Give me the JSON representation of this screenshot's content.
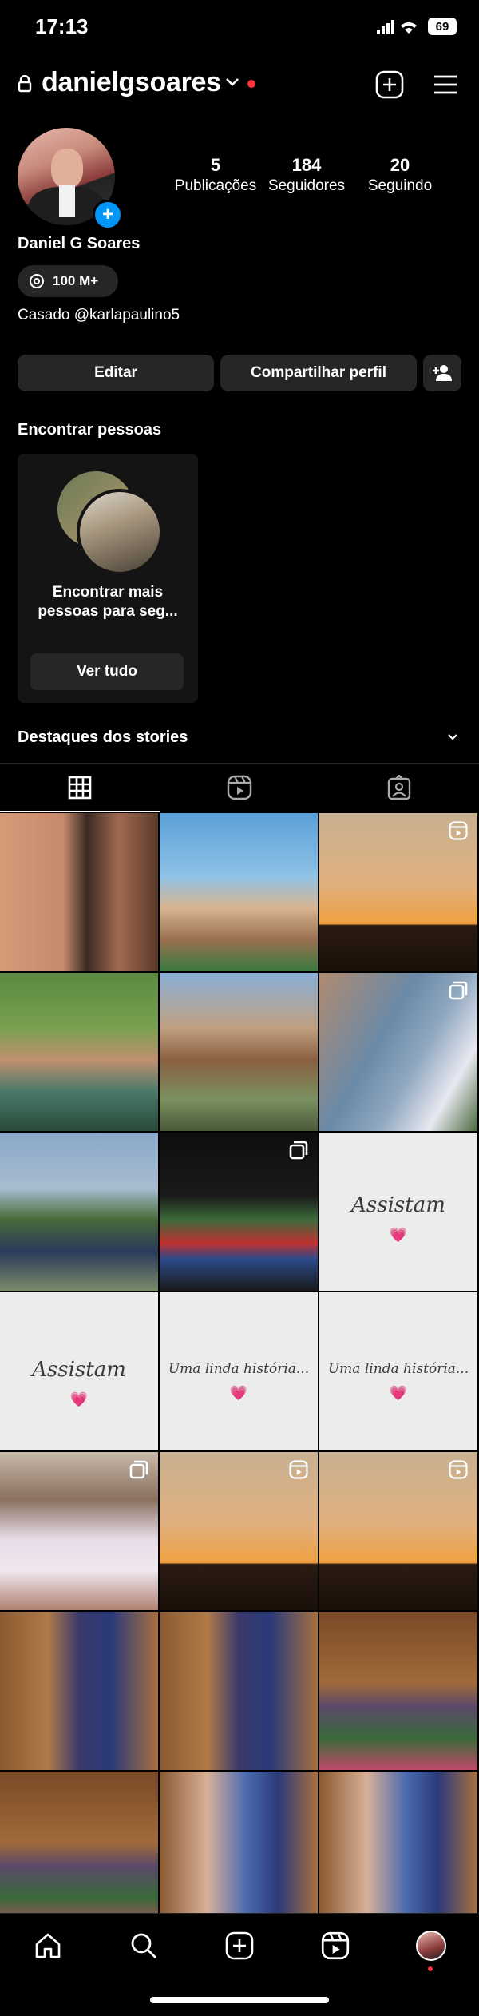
{
  "status_bar": {
    "time": "17:13",
    "battery": "69"
  },
  "profile": {
    "username": "danielgsoares",
    "name": "Daniel G Soares",
    "threads_label": "100 M+",
    "bio": "Casado @karlapaulino5",
    "stats": [
      {
        "value": "5",
        "label": "Publicações"
      },
      {
        "value": "184",
        "label": "Seguidores"
      },
      {
        "value": "20",
        "label": "Seguindo"
      }
    ]
  },
  "actions": {
    "edit": "Editar",
    "share": "Compartilhar perfil"
  },
  "find_people": {
    "title": "Encontrar pessoas",
    "card_text": "Encontrar mais pessoas para seg...",
    "button": "Ver tudo"
  },
  "highlights": {
    "title": "Destaques dos stories"
  },
  "grid": {
    "captions": {
      "assistam": "Assistam",
      "uma_linda": "Uma linda história..."
    },
    "heart": "💗"
  },
  "colors": {
    "accent": "#0095f6",
    "notification": "#ff3040",
    "background": "#000000"
  }
}
